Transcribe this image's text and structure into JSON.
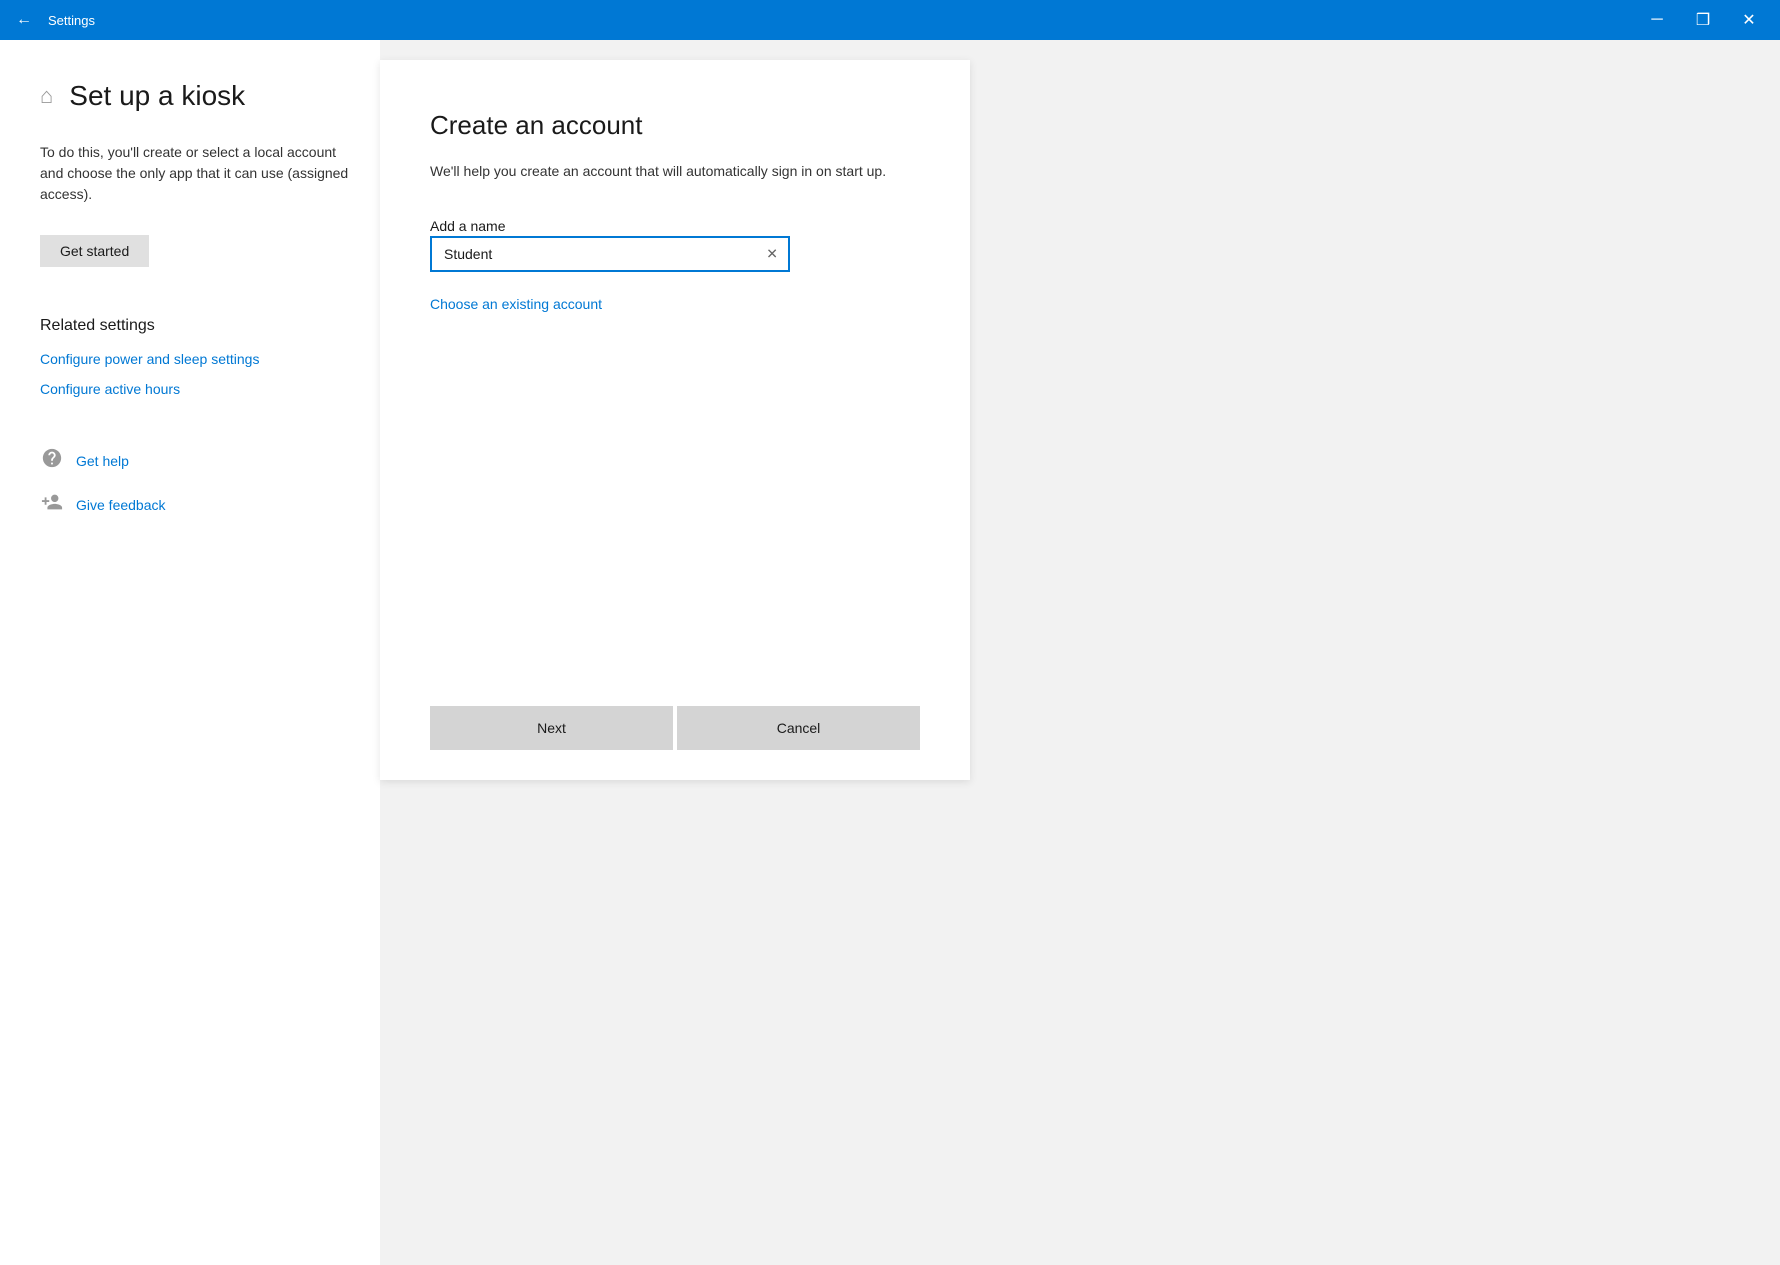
{
  "titlebar": {
    "title": "Settings",
    "back_icon": "←",
    "minimize_icon": "─",
    "restore_icon": "❒",
    "close_icon": "✕"
  },
  "page": {
    "home_icon": "⌂",
    "title": "Set up a kiosk",
    "description": "To do this, you'll create or select a local account and choose the only app that it can use (assigned access).",
    "get_started_label": "Get started"
  },
  "related_settings": {
    "title": "Related settings",
    "links": [
      {
        "label": "Configure power and sleep settings"
      },
      {
        "label": "Configure active hours"
      }
    ]
  },
  "help": {
    "items": [
      {
        "icon": "💬",
        "label": "Get help"
      },
      {
        "icon": "👤",
        "label": "Give feedback"
      }
    ]
  },
  "dialog": {
    "title": "Create an account",
    "description": "We'll help you create an account that will automatically sign in on start up.",
    "field_label": "Add a name",
    "input_value": "Student",
    "input_placeholder": "",
    "clear_icon": "✕",
    "choose_existing_label": "Choose an existing account",
    "next_label": "Next",
    "cancel_label": "Cancel"
  }
}
